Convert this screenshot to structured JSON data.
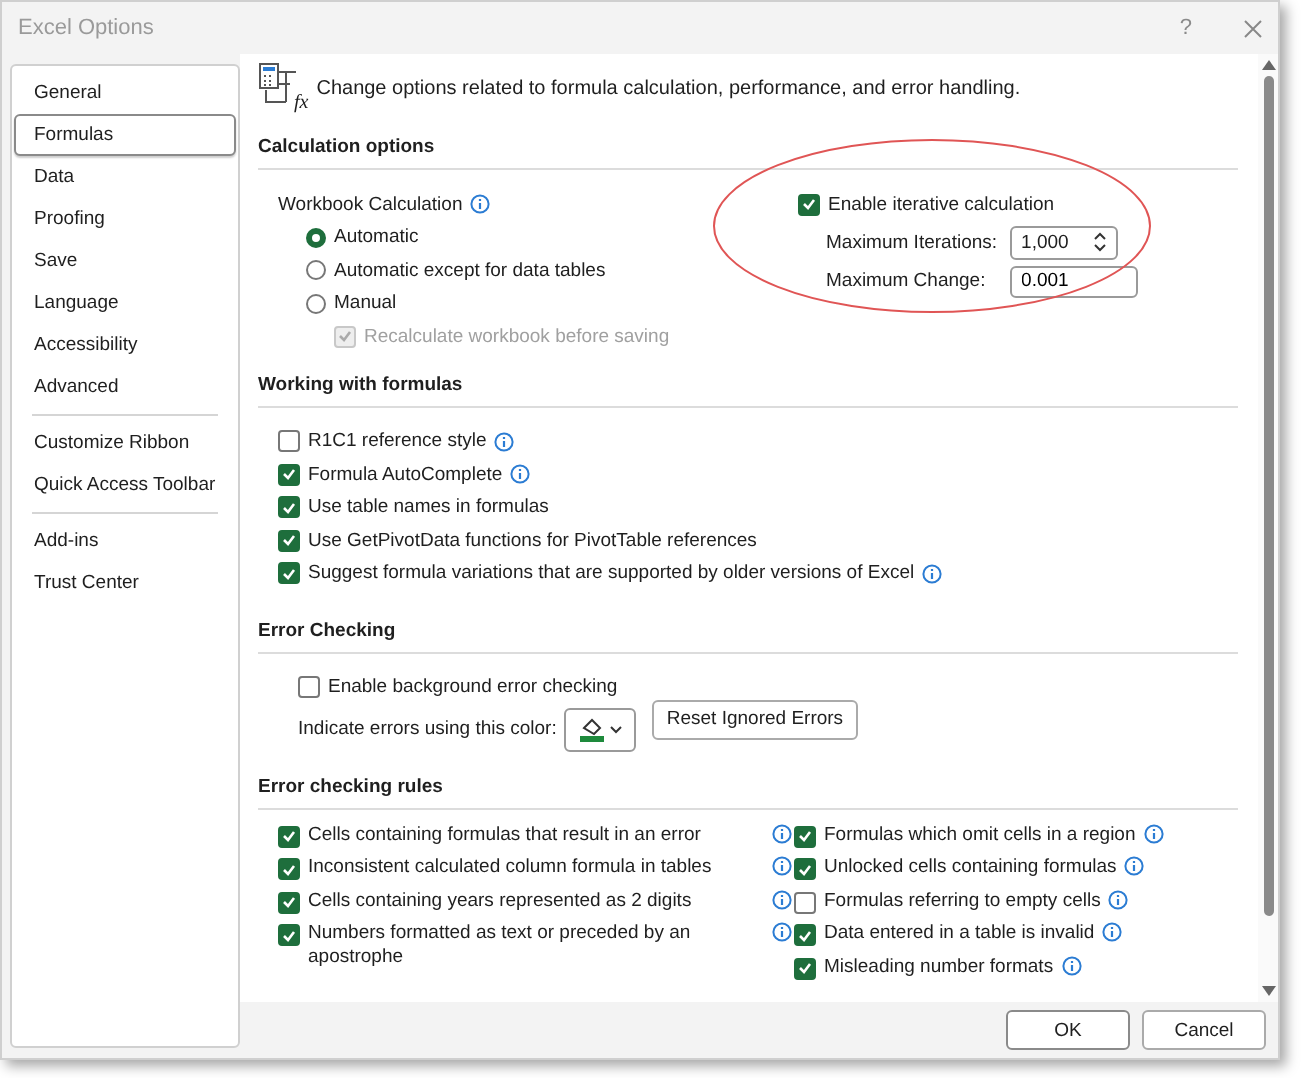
{
  "window": {
    "title": "Excel Options",
    "help": "?"
  },
  "sidebar": {
    "groups": [
      [
        {
          "label": "General",
          "selected": false
        },
        {
          "label": "Formulas",
          "selected": true
        },
        {
          "label": "Data",
          "selected": false
        },
        {
          "label": "Proofing",
          "selected": false
        },
        {
          "label": "Save",
          "selected": false
        },
        {
          "label": "Language",
          "selected": false
        },
        {
          "label": "Accessibility",
          "selected": false
        },
        {
          "label": "Advanced",
          "selected": false
        }
      ],
      [
        {
          "label": "Customize Ribbon",
          "selected": false
        },
        {
          "label": "Quick Access Toolbar",
          "selected": false
        }
      ],
      [
        {
          "label": "Add-ins",
          "selected": false
        },
        {
          "label": "Trust Center",
          "selected": false
        }
      ]
    ]
  },
  "header": {
    "icon_text": "fx",
    "text": "Change options related to formula calculation, performance, and error handling."
  },
  "calculation_options": {
    "title": "Calculation options",
    "workbook_label": "Workbook Calculation",
    "radios": [
      {
        "label": "Automatic",
        "selected": true
      },
      {
        "label": "Automatic except for data tables",
        "selected": false
      },
      {
        "label": "Manual",
        "selected": false
      }
    ],
    "recalc": {
      "label": "Recalculate workbook before saving",
      "checked": true,
      "disabled": true
    },
    "iterative": {
      "label": "Enable iterative calculation",
      "checked": true,
      "max_iterations_label": "Maximum Iterations:",
      "max_iterations": "1,000",
      "max_change_label": "Maximum Change:",
      "max_change": "0.001"
    }
  },
  "working_with_formulas": {
    "title": "Working with formulas",
    "items": [
      {
        "label": "R1C1 reference style",
        "checked": false,
        "info": true
      },
      {
        "label": "Formula AutoComplete",
        "checked": true,
        "info": true
      },
      {
        "label": "Use table names in formulas",
        "checked": true,
        "info": false
      },
      {
        "label": "Use GetPivotData functions for PivotTable references",
        "checked": true,
        "info": false
      },
      {
        "label": "Suggest formula variations that are supported by older versions of Excel",
        "checked": true,
        "info": true
      }
    ]
  },
  "error_checking": {
    "title": "Error Checking",
    "enable": {
      "label": "Enable background error checking",
      "checked": false
    },
    "color_label": "Indicate errors using this color:",
    "color": "#1e8a3c",
    "reset_button": "Reset Ignored Errors"
  },
  "error_checking_rules": {
    "title": "Error checking rules",
    "columns": [
      [
        {
          "label": "Cells containing formulas that result in an error",
          "checked": true
        },
        {
          "label": "Inconsistent calculated column formula in tables",
          "checked": true
        },
        {
          "label": "Cells containing years represented as 2 digits",
          "checked": true
        },
        {
          "label": "Numbers formatted as text or preceded by an apostrophe",
          "checked": true
        }
      ],
      [
        {
          "label": "Formulas which omit cells in a region",
          "checked": true
        },
        {
          "label": "Unlocked cells containing formulas",
          "checked": true
        },
        {
          "label": "Formulas referring to empty cells",
          "checked": false
        },
        {
          "label": "Data entered in a table is invalid",
          "checked": true
        },
        {
          "label": "Misleading number formats",
          "checked": true
        }
      ]
    ]
  },
  "buttons": [
    {
      "label": "OK",
      "kind": "primary"
    },
    {
      "label": "Cancel",
      "kind": "secondary"
    }
  ]
}
